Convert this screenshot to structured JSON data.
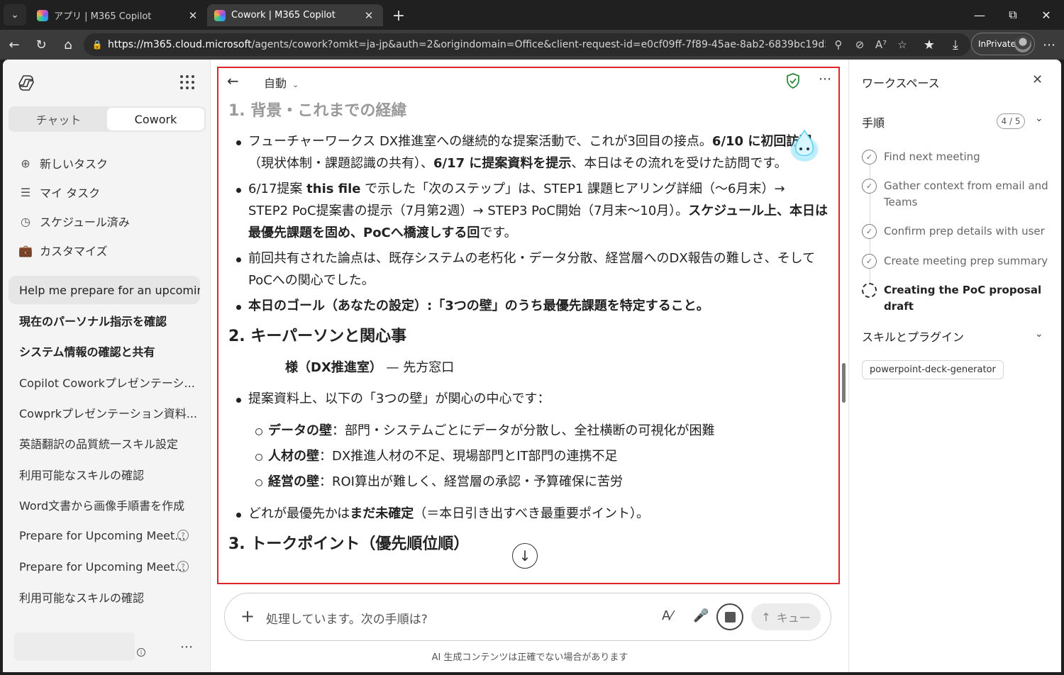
{
  "browser": {
    "tabs": [
      {
        "title": "アプリ | M365 Copilot"
      },
      {
        "title": "Cowork | M365 Copilot"
      }
    ],
    "url_host": "https://m365.cloud.microsoft",
    "url_path": "/agents/cowork?omkt=ja-jp&auth=2&origindomain=Office&client-request-id=e0cf09ff-7f89-45ae-8ab2-6839bc19d55e#/task...",
    "inprivate_label": "InPrivate"
  },
  "sidebar": {
    "mode_tabs": [
      "チャット",
      "Cowork"
    ],
    "active_mode": "Cowork",
    "actions": [
      {
        "label": "新しいタスク",
        "icon": "plus-circle-icon"
      },
      {
        "label": "マイ タスク",
        "icon": "task-list-icon"
      },
      {
        "label": "スケジュール済み",
        "icon": "clock-icon"
      },
      {
        "label": "カスタマイズ",
        "icon": "briefcase-icon"
      }
    ],
    "history": [
      {
        "label": "Help me prepare for an upcomin...",
        "style": "selected"
      },
      {
        "label": "現在のパーソナル指示を確認",
        "style": "bold"
      },
      {
        "label": "システム情報の確認と共有",
        "style": "bold"
      },
      {
        "label": "Copilot Coworkプレゼンテーシ...",
        "style": "normal"
      },
      {
        "label": "Cowprkプレゼンテーション資料...",
        "style": "normal"
      },
      {
        "label": "英語翻訳の品質統一スキル設定",
        "style": "normal"
      },
      {
        "label": "利用可能なスキルの確認",
        "style": "normal"
      },
      {
        "label": "Word文書から画像手順書を作成",
        "style": "normal"
      },
      {
        "label": "Prepare for Upcoming Meet...",
        "style": "badge"
      },
      {
        "label": "Prepare for Upcoming Meet...",
        "style": "badge"
      },
      {
        "label": "利用可能なスキルの確認",
        "style": "normal"
      }
    ]
  },
  "center": {
    "mode_label": "自動",
    "section1_heading": "1. 背景・これまでの経緯",
    "s1_b1_p1": "フューチャーワークス DX推進室への継続的な提案活動で、これが3回目の接点。",
    "s1_b1_p2": "6/10 に初回訪問",
    "s1_b1_p3": "（現状体制・課題認識の共有）、",
    "s1_b1_p4": "6/17 に提案資料を提示",
    "s1_b1_p5": "、本日はその流れを受けた訪問です。",
    "s1_b2_p1": "6/17提案 ",
    "s1_b2_p2": "this file",
    "s1_b2_p3": " で示した「次のステップ」は、STEP1 課題ヒアリング詳細（〜6月末）→ STEP2 PoC提案書の提示（7月第2週）→ STEP3 PoC開始（7月末〜10月）。",
    "s1_b2_p4": "スケジュール上、本日は最優先課題を固め、PoCへ橋渡しする回",
    "s1_b2_p5": "です。",
    "s1_b3": "前回共有された論点は、既存システムの老朽化・データ分散、経営層へのDX報告の難しさ、そしてPoCへの関心でした。",
    "s1_b4": "本日のゴール（あなたの設定）:「3つの壁」のうち最優先課題を特定すること。",
    "section2_heading": "2. キーパーソンと関心事",
    "s2_person_p1": "様（DX推進室）",
    "s2_person_p2": " — 先方窓口",
    "s2_b1": "提案資料上、以下の「3つの壁」が関心の中心です：",
    "s2_walls": [
      {
        "name": "データの壁",
        "desc": "：部門・システムごとにデータが分散し、全社横断の可視化が困難"
      },
      {
        "name": "人材の壁",
        "desc": "：DX推進人材の不足、現場部門とIT部門の連携不足"
      },
      {
        "name": "経営の壁",
        "desc": "：ROI算出が難しく、経営層の承認・予算確保に苦労"
      }
    ],
    "s2_b2_p1": "どれが最優先かは",
    "s2_b2_p2": "まだ未確定",
    "s2_b2_p3": "（＝本日引き出すべき最重要ポイント）。",
    "section3_heading": "3. トークポイント（優先順位順）",
    "composer_placeholder": "処理しています。次の手順は?",
    "queue_label": "キュー",
    "disclaimer": "AI 生成コンテンツは正確でない場合があります"
  },
  "workspace": {
    "title": "ワークスペース",
    "steps_label": "手順",
    "steps_count": "4 / 5",
    "steps": [
      {
        "label": "Find next meeting",
        "status": "done"
      },
      {
        "label": "Gather context from email and Teams",
        "status": "done"
      },
      {
        "label": "Confirm prep details with user",
        "status": "done"
      },
      {
        "label": "Create meeting prep summary",
        "status": "done"
      },
      {
        "label": "Creating the PoC proposal draft",
        "status": "in-progress"
      }
    ],
    "skills_label": "スキルとプラグイン",
    "skills": [
      "powerpoint-deck-generator"
    ]
  },
  "colors": {
    "highlight_frame": "#e0242a",
    "shield_green": "#2e8b3d"
  }
}
